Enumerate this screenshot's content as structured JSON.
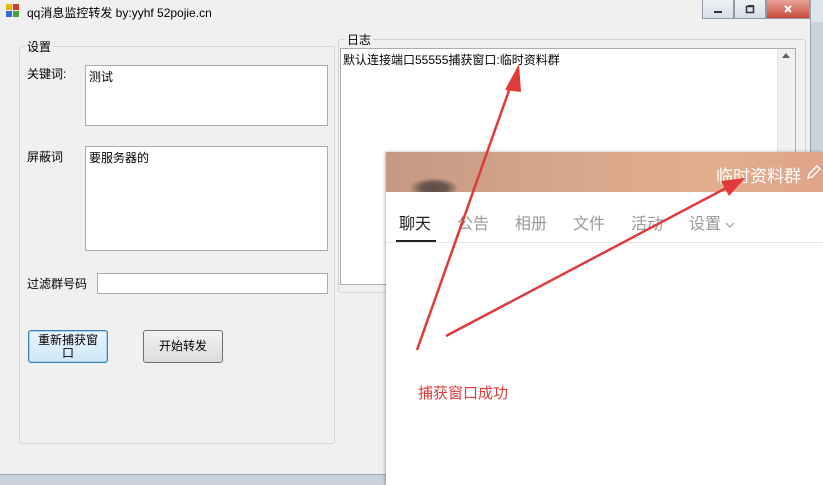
{
  "window": {
    "title": "qq消息监控转发 by:yyhf  52pojie.cn"
  },
  "settings": {
    "group_label": "设置",
    "keyword_label": "关键词:",
    "keyword_value": "测试",
    "block_label": "屏蔽词",
    "block_value": "要服务器的",
    "filter_label": "过滤群号码",
    "filter_value": "",
    "recapture_button": "重新捕获窗口",
    "start_button": "开始转发"
  },
  "log": {
    "group_label": "日志",
    "text": "默认连接端口55555捕获窗口:临时资料群"
  },
  "qq_panel": {
    "group_name": "临时资料群",
    "tabs": [
      {
        "label": "聊天",
        "active": true
      },
      {
        "label": "公告",
        "active": false
      },
      {
        "label": "相册",
        "active": false
      },
      {
        "label": "文件",
        "active": false
      },
      {
        "label": "活动",
        "active": false
      },
      {
        "label": "设置",
        "active": false
      }
    ]
  },
  "annotation": {
    "text": "捕获窗口成功",
    "color": "#e03a3a"
  },
  "colors": {
    "window_bg": "#f0f0f0",
    "header_gradient": "#d9a78c",
    "annotation_red": "#e03a3a"
  }
}
